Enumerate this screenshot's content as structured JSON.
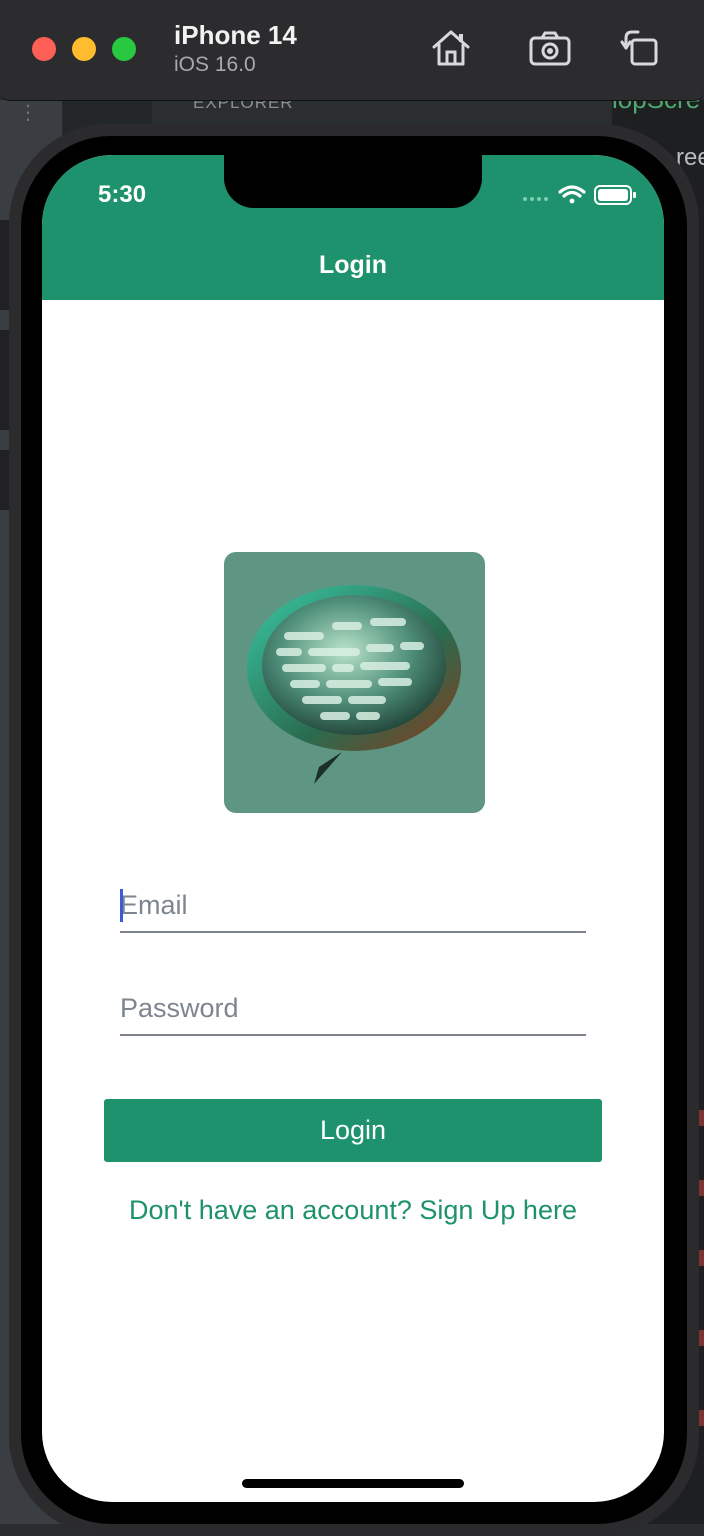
{
  "simulator": {
    "device_name": "iPhone 14",
    "os_version": "iOS 16.0",
    "toolbar_icons": [
      "home-icon",
      "screenshot-icon",
      "rotate-icon"
    ]
  },
  "background_editor": {
    "explorer_label": "EXPLORER",
    "explorer_more": "···",
    "tab_fragment": "lopScre",
    "text_fragment": "ree"
  },
  "status_bar": {
    "time": "5:30",
    "icons": [
      "signal-dots-icon",
      "wifi-icon",
      "battery-icon"
    ]
  },
  "header": {
    "title": "Login",
    "color": "#1d926c"
  },
  "logo": {
    "icon": "brain-speech-bubble-logo",
    "background": "#5f9683"
  },
  "form": {
    "email_placeholder": "Email",
    "password_placeholder": "Password",
    "login_label": "Login",
    "signup_link": "Don't have an account? Sign Up here"
  }
}
